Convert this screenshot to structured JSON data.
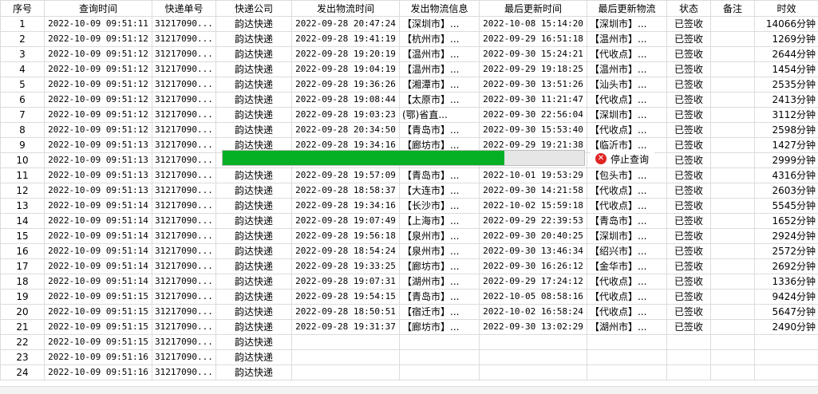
{
  "columns": [
    "序号",
    "查询时间",
    "快递单号",
    "快递公司",
    "发出物流时间",
    "发出物流信息",
    "最后更新时间",
    "最后更新物流",
    "状态",
    "备注",
    "时效"
  ],
  "rows": [
    {
      "no": "1",
      "qtime": "2022-10-09 09:51:11",
      "tracking": "31217090...",
      "company": "韵达快递",
      "send_time": "2022-09-28 20:47:24",
      "send_info": "【深圳市】...",
      "last_time": "2022-10-08 15:14:20",
      "last_info": "【深圳市】...",
      "status": "已签收",
      "remark": "",
      "duration": "14066分钟"
    },
    {
      "no": "2",
      "qtime": "2022-10-09 09:51:12",
      "tracking": "31217090...",
      "company": "韵达快递",
      "send_time": "2022-09-28 19:41:19",
      "send_info": "【杭州市】...",
      "last_time": "2022-09-29 16:51:18",
      "last_info": "【温州市】...",
      "status": "已签收",
      "remark": "",
      "duration": "1269分钟"
    },
    {
      "no": "3",
      "qtime": "2022-10-09 09:51:12",
      "tracking": "31217090...",
      "company": "韵达快递",
      "send_time": "2022-09-28 19:20:19",
      "send_info": "【温州市】...",
      "last_time": "2022-09-30 15:24:21",
      "last_info": "【代收点】...",
      "status": "已签收",
      "remark": "",
      "duration": "2644分钟"
    },
    {
      "no": "4",
      "qtime": "2022-10-09 09:51:12",
      "tracking": "31217090...",
      "company": "韵达快递",
      "send_time": "2022-09-28 19:04:19",
      "send_info": "【温州市】...",
      "last_time": "2022-09-29 19:18:25",
      "last_info": "【温州市】...",
      "status": "已签收",
      "remark": "",
      "duration": "1454分钟"
    },
    {
      "no": "5",
      "qtime": "2022-10-09 09:51:12",
      "tracking": "31217090...",
      "company": "韵达快递",
      "send_time": "2022-09-28 19:36:26",
      "send_info": "【湘潭市】...",
      "last_time": "2022-09-30 13:51:26",
      "last_info": "【汕头市】...",
      "status": "已签收",
      "remark": "",
      "duration": "2535分钟"
    },
    {
      "no": "6",
      "qtime": "2022-10-09 09:51:12",
      "tracking": "31217090...",
      "company": "韵达快递",
      "send_time": "2022-09-28 19:08:44",
      "send_info": "【太原市】...",
      "last_time": "2022-09-30 11:21:47",
      "last_info": "【代收点】...",
      "status": "已签收",
      "remark": "",
      "duration": "2413分钟"
    },
    {
      "no": "7",
      "qtime": "2022-10-09 09:51:12",
      "tracking": "31217090...",
      "company": "韵达快递",
      "send_time": "2022-09-28 19:03:23",
      "send_info": "(鄂)省直...",
      "last_time": "2022-09-30 22:56:04",
      "last_info": "【深圳市】...",
      "status": "已签收",
      "remark": "",
      "duration": "3112分钟"
    },
    {
      "no": "8",
      "qtime": "2022-10-09 09:51:12",
      "tracking": "31217090...",
      "company": "韵达快递",
      "send_time": "2022-09-28 20:34:50",
      "send_info": "【青岛市】...",
      "last_time": "2022-09-30 15:53:40",
      "last_info": "【代收点】...",
      "status": "已签收",
      "remark": "",
      "duration": "2598分钟"
    },
    {
      "no": "9",
      "qtime": "2022-10-09 09:51:13",
      "tracking": "31217090...",
      "company": "韵达快递",
      "send_time": "2022-09-28 19:34:16",
      "send_info": "【廊坊市】...",
      "last_time": "2022-09-29 19:21:38",
      "last_info": "【临沂市】...",
      "status": "已签收",
      "remark": "",
      "duration": "1427分钟"
    },
    {
      "no": "10",
      "qtime": "2022-10-09 09:51:13",
      "tracking": "31217090...",
      "company": "",
      "send_time": "",
      "send_info": "",
      "last_time": "",
      "last_info": "",
      "status": "已签收",
      "remark": "",
      "duration": "2999分钟"
    },
    {
      "no": "11",
      "qtime": "2022-10-09 09:51:13",
      "tracking": "31217090...",
      "company": "韵达快递",
      "send_time": "2022-09-28 19:57:09",
      "send_info": "【青岛市】...",
      "last_time": "2022-10-01 19:53:29",
      "last_info": "【包头市】...",
      "status": "已签收",
      "remark": "",
      "duration": "4316分钟"
    },
    {
      "no": "12",
      "qtime": "2022-10-09 09:51:13",
      "tracking": "31217090...",
      "company": "韵达快递",
      "send_time": "2022-09-28 18:58:37",
      "send_info": "【大连市】...",
      "last_time": "2022-09-30 14:21:58",
      "last_info": "【代收点】...",
      "status": "已签收",
      "remark": "",
      "duration": "2603分钟"
    },
    {
      "no": "13",
      "qtime": "2022-10-09 09:51:14",
      "tracking": "31217090...",
      "company": "韵达快递",
      "send_time": "2022-09-28 19:34:16",
      "send_info": "【长沙市】...",
      "last_time": "2022-10-02 15:59:18",
      "last_info": "【代收点】...",
      "status": "已签收",
      "remark": "",
      "duration": "5545分钟"
    },
    {
      "no": "14",
      "qtime": "2022-10-09 09:51:14",
      "tracking": "31217090...",
      "company": "韵达快递",
      "send_time": "2022-09-28 19:07:49",
      "send_info": "【上海市】...",
      "last_time": "2022-09-29 22:39:53",
      "last_info": "【青岛市】...",
      "status": "已签收",
      "remark": "",
      "duration": "1652分钟"
    },
    {
      "no": "15",
      "qtime": "2022-10-09 09:51:14",
      "tracking": "31217090...",
      "company": "韵达快递",
      "send_time": "2022-09-28 19:56:18",
      "send_info": "【泉州市】...",
      "last_time": "2022-09-30 20:40:25",
      "last_info": "【深圳市】...",
      "status": "已签收",
      "remark": "",
      "duration": "2924分钟"
    },
    {
      "no": "16",
      "qtime": "2022-10-09 09:51:14",
      "tracking": "31217090...",
      "company": "韵达快递",
      "send_time": "2022-09-28 18:54:24",
      "send_info": "【泉州市】...",
      "last_time": "2022-09-30 13:46:34",
      "last_info": "【绍兴市】...",
      "status": "已签收",
      "remark": "",
      "duration": "2572分钟"
    },
    {
      "no": "17",
      "qtime": "2022-10-09 09:51:14",
      "tracking": "31217090...",
      "company": "韵达快递",
      "send_time": "2022-09-28 19:33:25",
      "send_info": "【廊坊市】...",
      "last_time": "2022-09-30 16:26:12",
      "last_info": "【金华市】...",
      "status": "已签收",
      "remark": "",
      "duration": "2692分钟"
    },
    {
      "no": "18",
      "qtime": "2022-10-09 09:51:14",
      "tracking": "31217090...",
      "company": "韵达快递",
      "send_time": "2022-09-28 19:07:31",
      "send_info": "【湖州市】...",
      "last_time": "2022-09-29 17:24:12",
      "last_info": "【代收点】...",
      "status": "已签收",
      "remark": "",
      "duration": "1336分钟"
    },
    {
      "no": "19",
      "qtime": "2022-10-09 09:51:15",
      "tracking": "31217090...",
      "company": "韵达快递",
      "send_time": "2022-09-28 19:54:15",
      "send_info": "【青岛市】...",
      "last_time": "2022-10-05 08:58:16",
      "last_info": "【代收点】...",
      "status": "已签收",
      "remark": "",
      "duration": "9424分钟"
    },
    {
      "no": "20",
      "qtime": "2022-10-09 09:51:15",
      "tracking": "31217090...",
      "company": "韵达快递",
      "send_time": "2022-09-28 18:50:51",
      "send_info": "【宿迁市】...",
      "last_time": "2022-10-02 16:58:24",
      "last_info": "【代收点】...",
      "status": "已签收",
      "remark": "",
      "duration": "5647分钟"
    },
    {
      "no": "21",
      "qtime": "2022-10-09 09:51:15",
      "tracking": "31217090...",
      "company": "韵达快递",
      "send_time": "2022-09-28 19:31:37",
      "send_info": "【廊坊市】...",
      "last_time": "2022-09-30 13:02:29",
      "last_info": "【湖州市】...",
      "status": "已签收",
      "remark": "",
      "duration": "2490分钟"
    },
    {
      "no": "22",
      "qtime": "2022-10-09 09:51:15",
      "tracking": "31217090...",
      "company": "韵达快递",
      "send_time": "",
      "send_info": "",
      "last_time": "",
      "last_info": "",
      "status": "",
      "remark": "",
      "duration": ""
    },
    {
      "no": "23",
      "qtime": "2022-10-09 09:51:16",
      "tracking": "31217090...",
      "company": "韵达快递",
      "send_time": "",
      "send_info": "",
      "last_time": "",
      "last_info": "",
      "status": "",
      "remark": "",
      "duration": ""
    },
    {
      "no": "24",
      "qtime": "2022-10-09 09:51:16",
      "tracking": "31217090...",
      "company": "韵达快递",
      "send_time": "",
      "send_info": "",
      "last_time": "",
      "last_info": "",
      "status": "",
      "remark": "",
      "duration": ""
    }
  ],
  "progress": {
    "fraction": 0.78,
    "color": "#06b025"
  },
  "stop_button": {
    "label": "停止查询",
    "icon": "stop-circle-icon"
  }
}
